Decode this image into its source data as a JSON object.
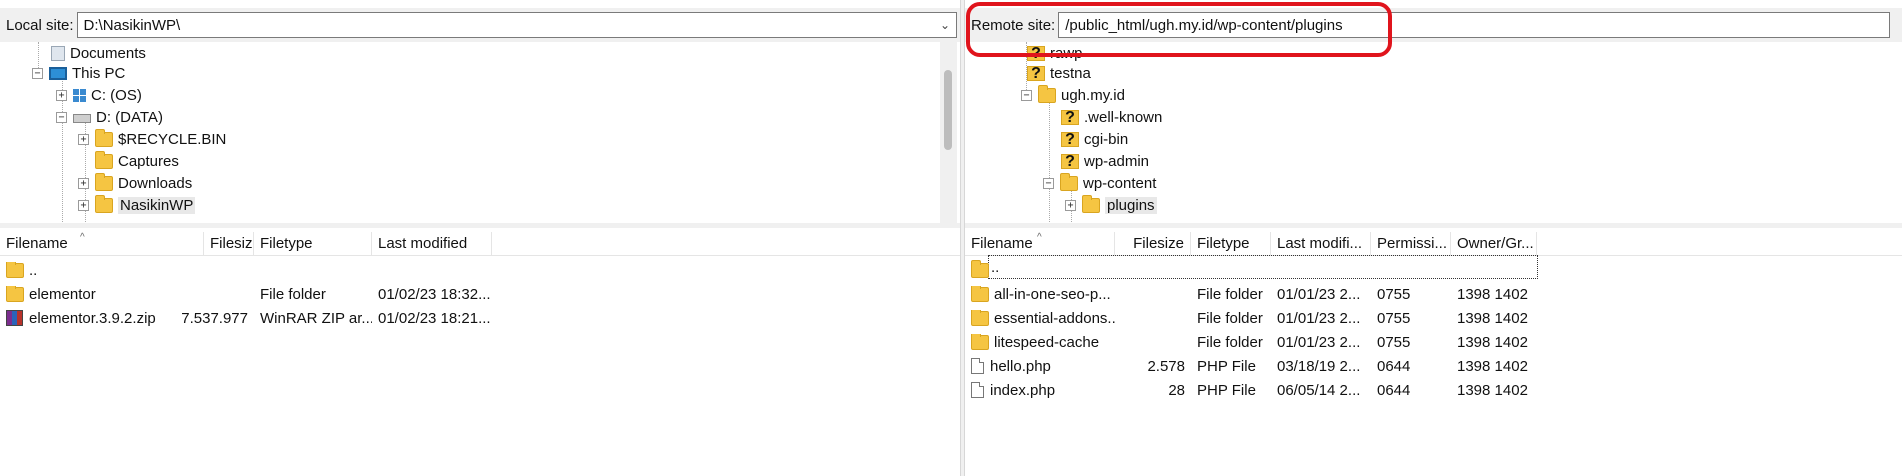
{
  "local": {
    "site_label": "Local site:",
    "site_path": "D:\\NasikinWP\\",
    "tree": [
      {
        "label": "Documents",
        "icon": "documents-icon"
      },
      {
        "label": "This PC",
        "icon": "computer-icon"
      },
      {
        "label": "C: (OS)",
        "icon": "windows-drive-icon"
      },
      {
        "label": "D: (DATA)",
        "icon": "drive-icon"
      },
      {
        "label": "$RECYCLE.BIN",
        "icon": "folder-icon"
      },
      {
        "label": "Captures",
        "icon": "folder-icon"
      },
      {
        "label": "Downloads",
        "icon": "folder-icon"
      },
      {
        "label": "NasikinWP",
        "icon": "folder-icon"
      }
    ],
    "columns": {
      "filename": "Filename",
      "filesize": "Filesize",
      "filetype": "Filetype",
      "modified": "Last modified"
    },
    "files": [
      {
        "name": "..",
        "size": "",
        "type": "",
        "modified": "",
        "icon": "folder-icon"
      },
      {
        "name": "elementor",
        "size": "",
        "type": "File folder",
        "modified": "01/02/23 18:32...",
        "icon": "folder-icon"
      },
      {
        "name": "elementor.3.9.2.zip",
        "size": "7.537.977",
        "type": "WinRAR ZIP ar...",
        "modified": "01/02/23 18:21...",
        "icon": "zip-archive-icon"
      }
    ]
  },
  "remote": {
    "site_label": "Remote site:",
    "site_path": "/public_html/ugh.my.id/wp-content/plugins",
    "tree": [
      {
        "label": "rawp",
        "icon": "unknown-folder-icon"
      },
      {
        "label": "testna",
        "icon": "unknown-folder-icon"
      },
      {
        "label": "ugh.my.id",
        "icon": "folder-icon"
      },
      {
        "label": ".well-known",
        "icon": "unknown-folder-icon"
      },
      {
        "label": "cgi-bin",
        "icon": "unknown-folder-icon"
      },
      {
        "label": "wp-admin",
        "icon": "unknown-folder-icon"
      },
      {
        "label": "wp-content",
        "icon": "folder-icon"
      },
      {
        "label": "plugins",
        "icon": "folder-icon"
      }
    ],
    "columns": {
      "filename": "Filename",
      "filesize": "Filesize",
      "filetype": "Filetype",
      "modified": "Last modifi...",
      "permissions": "Permissi...",
      "owner": "Owner/Gr..."
    },
    "files": [
      {
        "name": "..",
        "size": "",
        "type": "",
        "modified": "",
        "perm": "",
        "owner": "",
        "icon": "folder-icon"
      },
      {
        "name": "all-in-one-seo-p...",
        "size": "",
        "type": "File folder",
        "modified": "01/01/23 2...",
        "perm": "0755",
        "owner": "1398 1402",
        "icon": "folder-icon"
      },
      {
        "name": "essential-addons...",
        "size": "",
        "type": "File folder",
        "modified": "01/01/23 2...",
        "perm": "0755",
        "owner": "1398 1402",
        "icon": "folder-icon"
      },
      {
        "name": "litespeed-cache",
        "size": "",
        "type": "File folder",
        "modified": "01/01/23 2...",
        "perm": "0755",
        "owner": "1398 1402",
        "icon": "folder-icon"
      },
      {
        "name": "hello.php",
        "size": "2.578",
        "type": "PHP File",
        "modified": "03/18/19 2...",
        "perm": "0644",
        "owner": "1398 1402",
        "icon": "file-icon"
      },
      {
        "name": "index.php",
        "size": "28",
        "type": "PHP File",
        "modified": "06/05/14 2...",
        "perm": "0644",
        "owner": "1398 1402",
        "icon": "file-icon"
      }
    ]
  },
  "colors": {
    "annotation": "#e0141c",
    "folder": "#f5c542"
  }
}
